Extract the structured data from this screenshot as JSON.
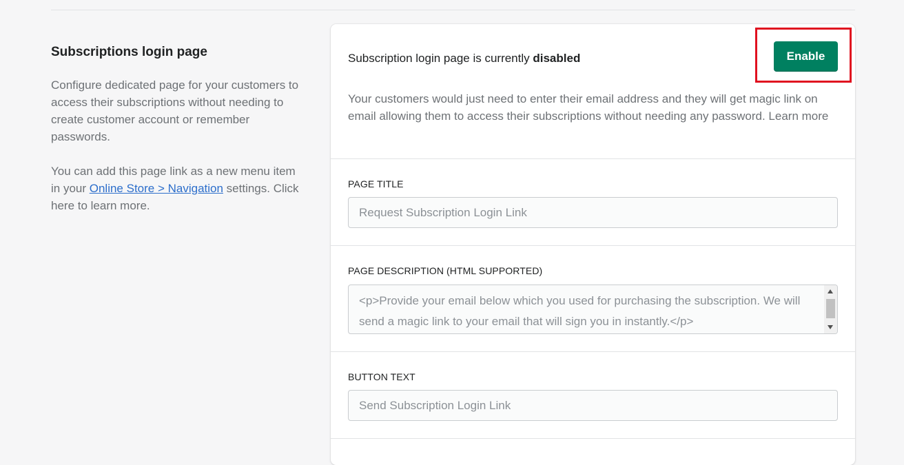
{
  "left": {
    "heading": "Subscriptions login page",
    "description": "Configure dedicated page for your customers to access their subscriptions without needing to create customer account or remember passwords.",
    "nav_prefix": "You can add this page link as a new menu item in your ",
    "nav_link": "Online Store > Navigation",
    "nav_suffix": " settings. Click here to learn more."
  },
  "status": {
    "prefix": "Subscription login page is currently ",
    "state": "disabled",
    "enable_label": "Enable",
    "description": "Your customers would just need to enter their email address and they will get magic link on email allowing them to access their subscriptions without needing any password. Learn more",
    "button_color": "#008060",
    "highlight_color": "#e0101f"
  },
  "fields": {
    "page_title": {
      "label": "PAGE TITLE",
      "placeholder": "Request Subscription Login Link"
    },
    "page_description": {
      "label": "PAGE DESCRIPTION (HTML SUPPORTED)",
      "placeholder": "<p>Provide your email below which you used for purchasing the subscription. We will send a magic link to your email that will sign you in instantly.</p>"
    },
    "button_text": {
      "label": "BUTTON TEXT",
      "placeholder": "Send Subscription Login Link"
    }
  }
}
